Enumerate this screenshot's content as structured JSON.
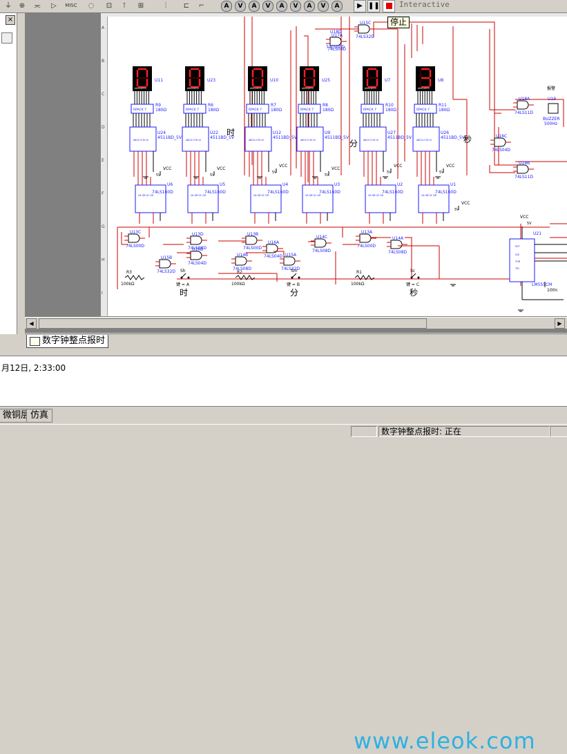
{
  "toolbar": {
    "misc_label": "MISC",
    "circle_buttons": [
      "A",
      "V",
      "A",
      "V",
      "A",
      "V",
      "A",
      "V",
      "A"
    ],
    "mode_label": "Interactive",
    "stop_tooltip": "停止"
  },
  "document_tab": {
    "label": "数字钟整点报时"
  },
  "log": {
    "line": "月12日, 2:33:00"
  },
  "watermark": "www.eleok.com",
  "bottom_tabs": [
    "微铜层",
    "仿真"
  ],
  "status": {
    "message": "数字钟整点报时: 正在"
  },
  "schematic": {
    "displays": [
      {
        "ref": "U11",
        "digit": "0"
      },
      {
        "ref": "U23",
        "digit": "0"
      },
      {
        "ref": "U10",
        "digit": "0"
      },
      {
        "ref": "U25",
        "digit": "0"
      },
      {
        "ref": "U7",
        "digit": "0"
      },
      {
        "ref": "U8",
        "digit": "3"
      }
    ],
    "rpacks": [
      {
        "ref": "R9",
        "val": "180Ω"
      },
      {
        "ref": "R6",
        "val": "180Ω"
      },
      {
        "ref": "R7",
        "val": "180Ω"
      },
      {
        "ref": "R8",
        "val": "180Ω"
      },
      {
        "ref": "R10",
        "val": "180Ω"
      },
      {
        "ref": "R11",
        "val": "180Ω"
      }
    ],
    "rpack_part": "RPACK 7",
    "decoders": [
      {
        "ref": "U24",
        "part": "4511BD_5V"
      },
      {
        "ref": "U22",
        "part": "4511BD_5V"
      },
      {
        "ref": "U12",
        "part": "4511BD_5V"
      },
      {
        "ref": "U9",
        "part": "4511BD_5V"
      },
      {
        "ref": "U27",
        "part": "4511BD_5V"
      },
      {
        "ref": "U26",
        "part": "4511BD_5V"
      }
    ],
    "counters": [
      {
        "ref": "U6",
        "part": "74LS160D"
      },
      {
        "ref": "U5",
        "part": "74LS160D"
      },
      {
        "ref": "U4",
        "part": "74LS160D"
      },
      {
        "ref": "U3",
        "part": "74LS160D"
      },
      {
        "ref": "U2",
        "part": "74LS160D"
      },
      {
        "ref": "U1",
        "part": "74LS160D"
      }
    ],
    "vcc": "VCC",
    "v5": "5V",
    "unit_labels": [
      "时",
      "分",
      "秒"
    ],
    "gates": [
      {
        "ref": "U13C",
        "part": "74LS00D"
      },
      {
        "ref": "U13D",
        "part": "74LS08D"
      },
      {
        "ref": "U16B",
        "part": "74LS04D"
      },
      {
        "ref": "U15B",
        "part": "74LS32D"
      },
      {
        "ref": "U13B",
        "part": "74LS00D"
      },
      {
        "ref": "U16A",
        "part": "74LS04D"
      },
      {
        "ref": "U14B",
        "part": "74LS08D"
      },
      {
        "ref": "U15A",
        "part": "74LS32D"
      },
      {
        "ref": "U14C",
        "part": "74LS08D"
      },
      {
        "ref": "U13A",
        "part": "74LS00D"
      },
      {
        "ref": "U14A",
        "part": "74LS08D"
      },
      {
        "ref": "U15C",
        "part": "74LS32D"
      },
      {
        "ref": "U17A",
        "part": "74LS04D"
      },
      {
        "ref": "U18A",
        "part": "74LS11D"
      },
      {
        "ref": "U18B",
        "part": "74LS11D"
      },
      {
        "ref": "U16C",
        "part": "74LS04D"
      }
    ],
    "top_gate_ref": "U18D",
    "top_gate_part": "74LS00D",
    "switches": [
      {
        "ref": "Sh",
        "key": "键 = A",
        "label": "时",
        "res": "R3",
        "rval": "100kΩ"
      },
      {
        "ref": "Sm",
        "key": "键 = B",
        "label": "分",
        "res": "R2",
        "rval": "100kΩ"
      },
      {
        "ref": "Sc",
        "key": "键 = C",
        "label": "秒",
        "res": "R1",
        "rval": "100kΩ"
      }
    ],
    "buzzer": {
      "ref": "U19",
      "part": "BUZZER",
      "freq": "500Hz",
      "label": "报警"
    },
    "timer": {
      "ref": "U21",
      "part": "LM555CM"
    },
    "timer_cap": "100n",
    "ruler_letters": [
      "A",
      "B",
      "C",
      "D",
      "E",
      "F",
      "G",
      "H",
      "I"
    ]
  }
}
